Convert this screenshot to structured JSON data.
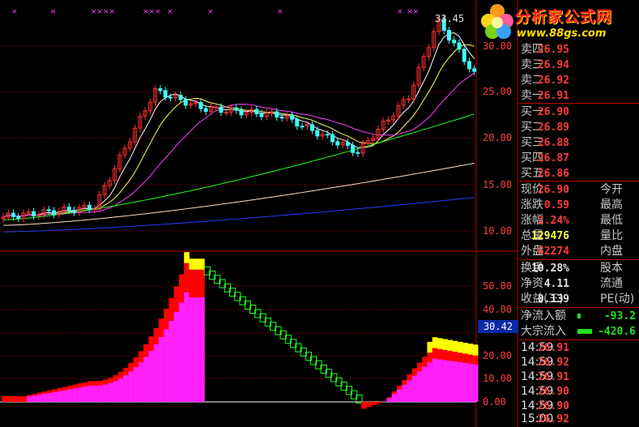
{
  "brand": {
    "title": "分析家公式网",
    "url": "www.88gs.com"
  },
  "main_chart": {
    "peak_label": "33.45",
    "y_ticks": [
      "30.00",
      "25.00",
      "20.00",
      "15.00",
      "10.00"
    ]
  },
  "indicator_chart": {
    "y_ticks": [
      "50.00",
      "40.00",
      "30.00",
      "20.00",
      "10.00",
      "0.00"
    ],
    "current_value": "30.42"
  },
  "order_book": {
    "asks": [
      {
        "label": "卖四",
        "price": "26.95"
      },
      {
        "label": "卖三",
        "price": "26.94"
      },
      {
        "label": "卖二",
        "price": "26.92"
      },
      {
        "label": "卖一",
        "price": "26.91"
      }
    ],
    "bids": [
      {
        "label": "买一",
        "price": "26.90"
      },
      {
        "label": "买二",
        "price": "26.89"
      },
      {
        "label": "买三",
        "price": "26.88"
      },
      {
        "label": "买四",
        "price": "26.87"
      },
      {
        "label": "买五",
        "price": "26.86"
      }
    ]
  },
  "quote": {
    "rows": [
      {
        "l1": "现价",
        "v1": "26.90",
        "l2": "今开"
      },
      {
        "l1": "涨跌",
        "v1": "0.59",
        "l2": "最高"
      },
      {
        "l1": "涨幅",
        "v1": "2.24%",
        "l2": "最低"
      },
      {
        "l1": "总量",
        "v1": "129476",
        "l2": "量比"
      },
      {
        "l1": "外盘",
        "v1": "62274",
        "l2": "内盘"
      }
    ],
    "turnover_label": "换手",
    "turnover_value": "10.28%",
    "turnover_tail": "股本",
    "net_asset_label": "净资",
    "net_asset_value": "4.11",
    "net_asset_tail": "流通",
    "eps_label": "收益(三)",
    "eps_value": "0.139",
    "eps_tail": "PE(动)",
    "net_inflow_label": "净流入额",
    "net_inflow_value": "-93.2",
    "block_inflow_label": "大宗流入",
    "block_inflow_value": "-420.6"
  },
  "ticks": [
    {
      "time": "14:59",
      "price": "26.91"
    },
    {
      "time": "14:59",
      "price": "26.92"
    },
    {
      "time": "14:59",
      "price": "26.91"
    },
    {
      "time": "14:59",
      "price": "26.90"
    },
    {
      "time": "14:59",
      "price": "26.90"
    },
    {
      "time": "15:00",
      "price": "26.92"
    }
  ],
  "colors": {
    "up": "#ff3030",
    "down": "#40ffff",
    "grid": "#a00000",
    "ma5": "#ffffff",
    "ma10": "#ffff60",
    "ma20": "#ff40ff",
    "ma30": "#20ff20",
    "ma60": "#ffe0c0",
    "ma120": "#2040ff",
    "bar_magenta": "#ff20ff",
    "bar_yellow": "#ffff00",
    "bar_green": "#20ff20"
  }
}
